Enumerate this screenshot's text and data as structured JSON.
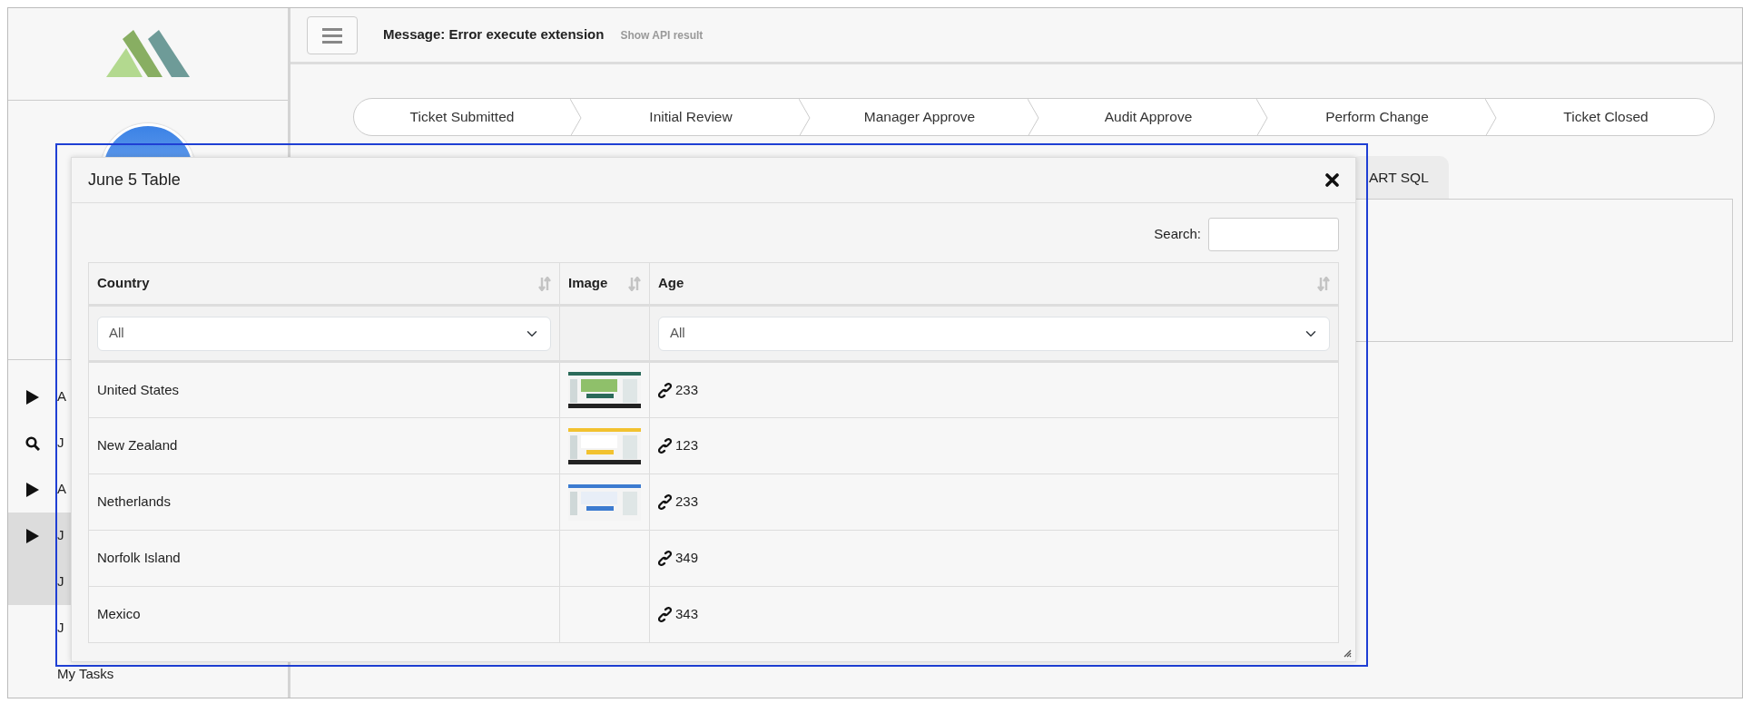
{
  "sidebar": {
    "items": [
      {
        "label": "A",
        "kind": "play",
        "selected": false
      },
      {
        "label": "J",
        "kind": "search",
        "selected": false
      },
      {
        "label": "A",
        "kind": "play",
        "selected": false
      },
      {
        "label": "J",
        "kind": "play",
        "selected": true,
        "children": [
          {
            "label": "J",
            "selected": true
          }
        ]
      },
      {
        "label": "J",
        "kind": "plain",
        "selected": false
      },
      {
        "label": "My Tasks",
        "kind": "plain",
        "selected": false
      }
    ]
  },
  "header": {
    "message": "Message: Error execute extension",
    "link": "Show API result"
  },
  "steps": [
    "Ticket Submitted",
    "Initial Review",
    "Manager Approve",
    "Audit Approve",
    "Perform Change",
    "Ticket Closed"
  ],
  "tabs": [
    {
      "label": "ART SQL"
    }
  ],
  "modal": {
    "title": "June 5 Table",
    "search_label": "Search:",
    "columns": [
      {
        "label": "Country",
        "filter": "All"
      },
      {
        "label": "Image"
      },
      {
        "label": "Age",
        "filter": "All"
      }
    ],
    "rows": [
      {
        "country": "United States",
        "image": true,
        "age": "233"
      },
      {
        "country": "New Zealand",
        "image": true,
        "age": "123"
      },
      {
        "country": "Netherlands",
        "image": true,
        "age": "233"
      },
      {
        "country": "Norfolk Island",
        "image": false,
        "age": "349"
      },
      {
        "country": "Mexico",
        "image": false,
        "age": "343"
      }
    ]
  }
}
